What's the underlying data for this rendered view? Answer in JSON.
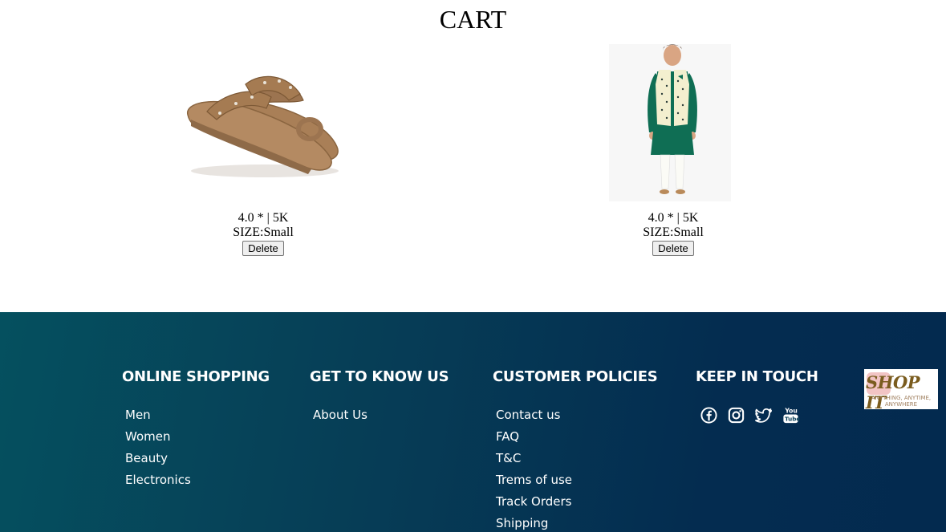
{
  "page": {
    "title": "CART"
  },
  "products": [
    {
      "image_alt": "brown kolhapuri sandal",
      "rating": "4.0 * | 5K",
      "size": "SIZE:Small",
      "delete_label": "Delete"
    },
    {
      "image_alt": "man in green kurta with cream nehru jacket",
      "rating": "4.0 * | 5K",
      "size": "SIZE:Small",
      "delete_label": "Delete"
    }
  ],
  "footer": {
    "online_shopping": {
      "heading": "ONLINE SHOPPING",
      "links": [
        "Men",
        "Women",
        "Beauty",
        "Electronics"
      ]
    },
    "get_to_know_us": {
      "heading": "GET TO KNOW US",
      "links": [
        "About Us"
      ]
    },
    "customer_policies": {
      "heading": "CUSTOMER POLICIES",
      "links": [
        "Contact us",
        "FAQ",
        "T&C",
        "Trems of use",
        "Track Orders",
        "Shipping"
      ]
    },
    "keep_in_touch": {
      "heading": "KEEP IN TOUCH",
      "icons": [
        "facebook-icon",
        "instagram-icon",
        "twitter-icon",
        "youtube-icon"
      ]
    },
    "logo": {
      "main": "SHOP IT",
      "tagline": "ANYTHING, ANYTIME, ANYWHERE"
    }
  },
  "colors": {
    "footer_start": "#05505f",
    "footer_end": "#032a4f",
    "footer_text": "#ffffff"
  }
}
